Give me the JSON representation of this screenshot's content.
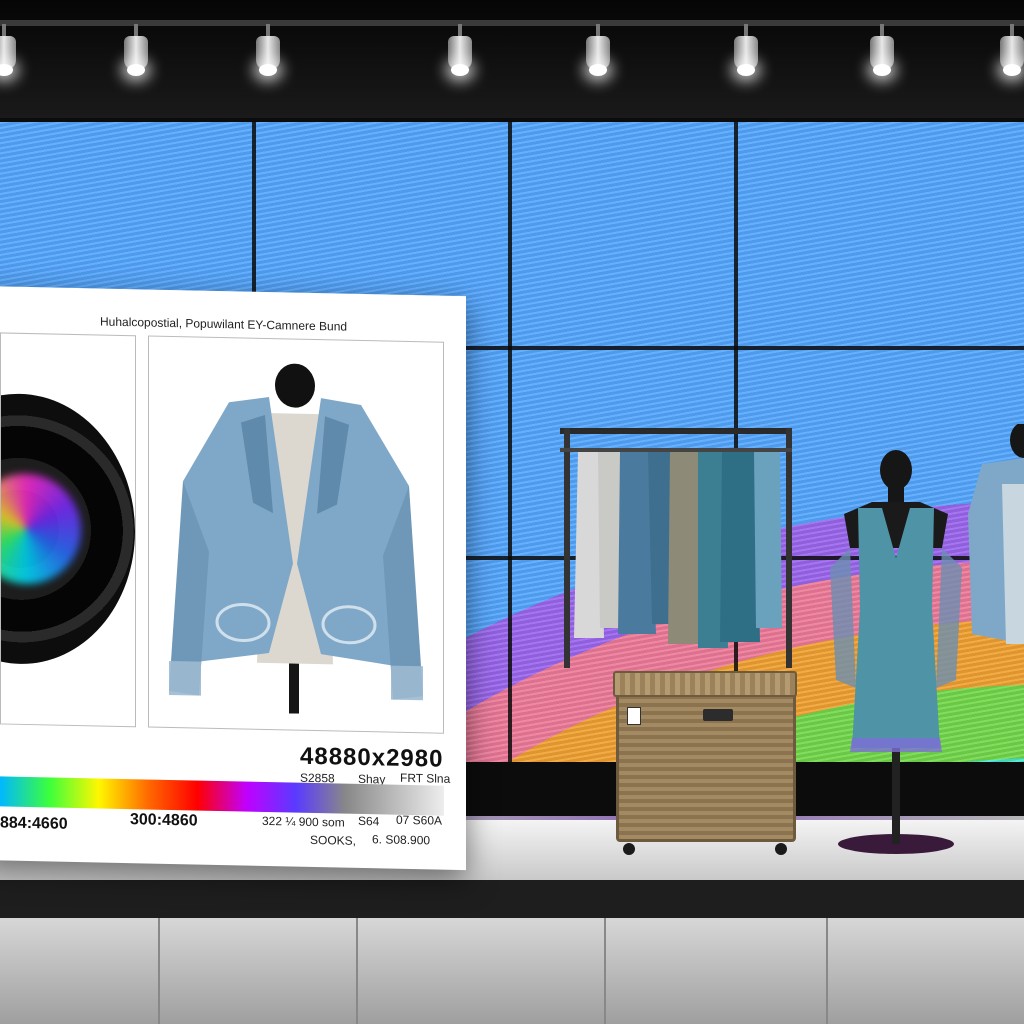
{
  "panel": {
    "title": "Huhalcopostial, Popuwilant EY-Camnere Bund",
    "big_number": "48880x2980",
    "spec_1": "S2858",
    "spec_2": "Shay",
    "spec_3": "FRT Slna",
    "scale_left": "884:4660",
    "scale_mid": "300:4860",
    "spec_4": "322 ¼ 900 som",
    "spec_5": "S64",
    "spec_6": "07 S60A",
    "spec_7": "SOOKS,",
    "spec_8": "6. S08.900"
  },
  "colors": {
    "wall": "#0c0c0c",
    "panel": "#ffffff",
    "jacket": "#7fa8c8",
    "dress": "#4e93a6",
    "spotlight": "#ffffff"
  },
  "icons": [
    "spotlight-icon",
    "camera-lens-icon"
  ]
}
